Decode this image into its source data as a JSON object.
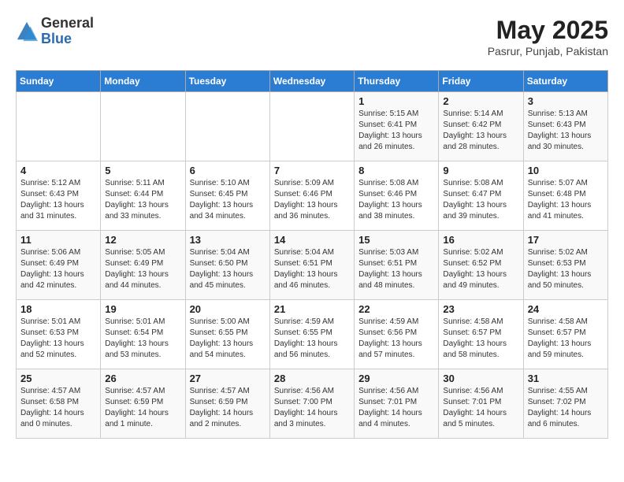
{
  "header": {
    "logo_general": "General",
    "logo_blue": "Blue",
    "month_title": "May 2025",
    "location": "Pasrur, Punjab, Pakistan"
  },
  "days_of_week": [
    "Sunday",
    "Monday",
    "Tuesday",
    "Wednesday",
    "Thursday",
    "Friday",
    "Saturday"
  ],
  "weeks": [
    [
      {
        "day": "",
        "content": ""
      },
      {
        "day": "",
        "content": ""
      },
      {
        "day": "",
        "content": ""
      },
      {
        "day": "",
        "content": ""
      },
      {
        "day": "1",
        "content": "Sunrise: 5:15 AM\nSunset: 6:41 PM\nDaylight: 13 hours\nand 26 minutes."
      },
      {
        "day": "2",
        "content": "Sunrise: 5:14 AM\nSunset: 6:42 PM\nDaylight: 13 hours\nand 28 minutes."
      },
      {
        "day": "3",
        "content": "Sunrise: 5:13 AM\nSunset: 6:43 PM\nDaylight: 13 hours\nand 30 minutes."
      }
    ],
    [
      {
        "day": "4",
        "content": "Sunrise: 5:12 AM\nSunset: 6:43 PM\nDaylight: 13 hours\nand 31 minutes."
      },
      {
        "day": "5",
        "content": "Sunrise: 5:11 AM\nSunset: 6:44 PM\nDaylight: 13 hours\nand 33 minutes."
      },
      {
        "day": "6",
        "content": "Sunrise: 5:10 AM\nSunset: 6:45 PM\nDaylight: 13 hours\nand 34 minutes."
      },
      {
        "day": "7",
        "content": "Sunrise: 5:09 AM\nSunset: 6:46 PM\nDaylight: 13 hours\nand 36 minutes."
      },
      {
        "day": "8",
        "content": "Sunrise: 5:08 AM\nSunset: 6:46 PM\nDaylight: 13 hours\nand 38 minutes."
      },
      {
        "day": "9",
        "content": "Sunrise: 5:08 AM\nSunset: 6:47 PM\nDaylight: 13 hours\nand 39 minutes."
      },
      {
        "day": "10",
        "content": "Sunrise: 5:07 AM\nSunset: 6:48 PM\nDaylight: 13 hours\nand 41 minutes."
      }
    ],
    [
      {
        "day": "11",
        "content": "Sunrise: 5:06 AM\nSunset: 6:49 PM\nDaylight: 13 hours\nand 42 minutes."
      },
      {
        "day": "12",
        "content": "Sunrise: 5:05 AM\nSunset: 6:49 PM\nDaylight: 13 hours\nand 44 minutes."
      },
      {
        "day": "13",
        "content": "Sunrise: 5:04 AM\nSunset: 6:50 PM\nDaylight: 13 hours\nand 45 minutes."
      },
      {
        "day": "14",
        "content": "Sunrise: 5:04 AM\nSunset: 6:51 PM\nDaylight: 13 hours\nand 46 minutes."
      },
      {
        "day": "15",
        "content": "Sunrise: 5:03 AM\nSunset: 6:51 PM\nDaylight: 13 hours\nand 48 minutes."
      },
      {
        "day": "16",
        "content": "Sunrise: 5:02 AM\nSunset: 6:52 PM\nDaylight: 13 hours\nand 49 minutes."
      },
      {
        "day": "17",
        "content": "Sunrise: 5:02 AM\nSunset: 6:53 PM\nDaylight: 13 hours\nand 50 minutes."
      }
    ],
    [
      {
        "day": "18",
        "content": "Sunrise: 5:01 AM\nSunset: 6:53 PM\nDaylight: 13 hours\nand 52 minutes."
      },
      {
        "day": "19",
        "content": "Sunrise: 5:01 AM\nSunset: 6:54 PM\nDaylight: 13 hours\nand 53 minutes."
      },
      {
        "day": "20",
        "content": "Sunrise: 5:00 AM\nSunset: 6:55 PM\nDaylight: 13 hours\nand 54 minutes."
      },
      {
        "day": "21",
        "content": "Sunrise: 4:59 AM\nSunset: 6:55 PM\nDaylight: 13 hours\nand 56 minutes."
      },
      {
        "day": "22",
        "content": "Sunrise: 4:59 AM\nSunset: 6:56 PM\nDaylight: 13 hours\nand 57 minutes."
      },
      {
        "day": "23",
        "content": "Sunrise: 4:58 AM\nSunset: 6:57 PM\nDaylight: 13 hours\nand 58 minutes."
      },
      {
        "day": "24",
        "content": "Sunrise: 4:58 AM\nSunset: 6:57 PM\nDaylight: 13 hours\nand 59 minutes."
      }
    ],
    [
      {
        "day": "25",
        "content": "Sunrise: 4:57 AM\nSunset: 6:58 PM\nDaylight: 14 hours\nand 0 minutes."
      },
      {
        "day": "26",
        "content": "Sunrise: 4:57 AM\nSunset: 6:59 PM\nDaylight: 14 hours\nand 1 minute."
      },
      {
        "day": "27",
        "content": "Sunrise: 4:57 AM\nSunset: 6:59 PM\nDaylight: 14 hours\nand 2 minutes."
      },
      {
        "day": "28",
        "content": "Sunrise: 4:56 AM\nSunset: 7:00 PM\nDaylight: 14 hours\nand 3 minutes."
      },
      {
        "day": "29",
        "content": "Sunrise: 4:56 AM\nSunset: 7:01 PM\nDaylight: 14 hours\nand 4 minutes."
      },
      {
        "day": "30",
        "content": "Sunrise: 4:56 AM\nSunset: 7:01 PM\nDaylight: 14 hours\nand 5 minutes."
      },
      {
        "day": "31",
        "content": "Sunrise: 4:55 AM\nSunset: 7:02 PM\nDaylight: 14 hours\nand 6 minutes."
      }
    ]
  ]
}
